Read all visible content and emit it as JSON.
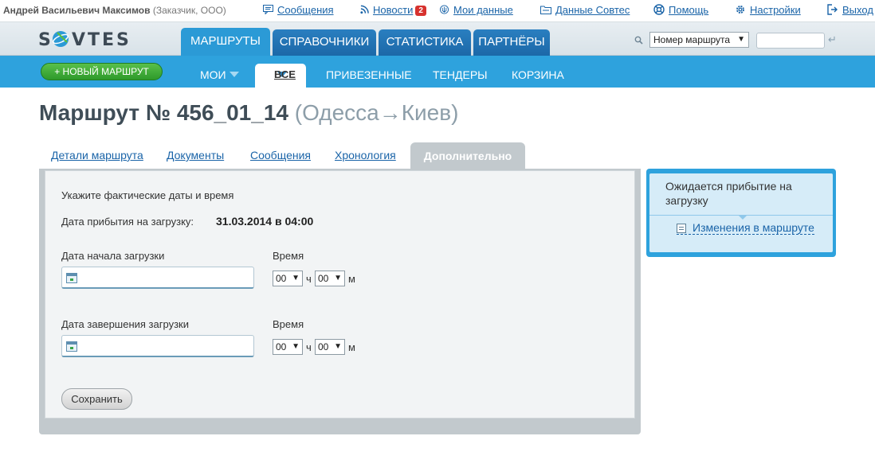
{
  "user": {
    "name": "Андрей Васильевич Максимов",
    "role": "(Заказчик, ООО)"
  },
  "toplinks": {
    "messages": "Сообщения",
    "news": "Новости",
    "news_count": "2",
    "my_data": "Мои данные",
    "sovtes_data": "Данные Совтес",
    "help": "Помощь",
    "settings": "Настройки",
    "logout": "Выход"
  },
  "logo": {
    "text": "SOVTES"
  },
  "main_tabs": [
    "МАРШРУТЫ",
    "СПРАВОЧНИКИ",
    "СТАТИСТИКА",
    "ПАРТНЁРЫ"
  ],
  "search": {
    "select_value": "Номер маршрута",
    "input_value": ""
  },
  "new_route_button": "+ НОВЫЙ МАРШРУТ",
  "sub_tabs": [
    "МОИ",
    "ВСЕ",
    "ПРИВЕЗЕННЫЕ",
    "ТЕНДЕРЫ",
    "КОРЗИНА"
  ],
  "title": {
    "prefix": "Маршрут № 456_01_14",
    "route": "(Одесса→Киев)"
  },
  "detail_tabs": [
    "Детали маршрута",
    "Документы",
    "Сообщения",
    "Хронология",
    "Дополнительно"
  ],
  "form": {
    "intro": "Укажите фактические даты и время",
    "arrival_label": "Дата прибытия на загрузку:",
    "arrival_value": "31.03.2014 в 04:00",
    "start_label": "Дата начала загрузки",
    "end_label": "Дата завершения загрузки",
    "time_label": "Время",
    "start_date_value": "",
    "end_date_value": "",
    "hours_value": "00",
    "minutes_value": "00",
    "hours_unit": "ч",
    "minutes_unit": "м",
    "save_label": "Сохранить"
  },
  "status": {
    "title": "Ожидается прибытие на загрузку",
    "link": "Изменения в маршруте"
  },
  "colors": {
    "nav_blue": "#2ea2dd",
    "active_tab": "#2b9ad6",
    "green_button": "#3aa839",
    "panel_grey": "#c2c9cd",
    "link": "#1a64a8"
  }
}
